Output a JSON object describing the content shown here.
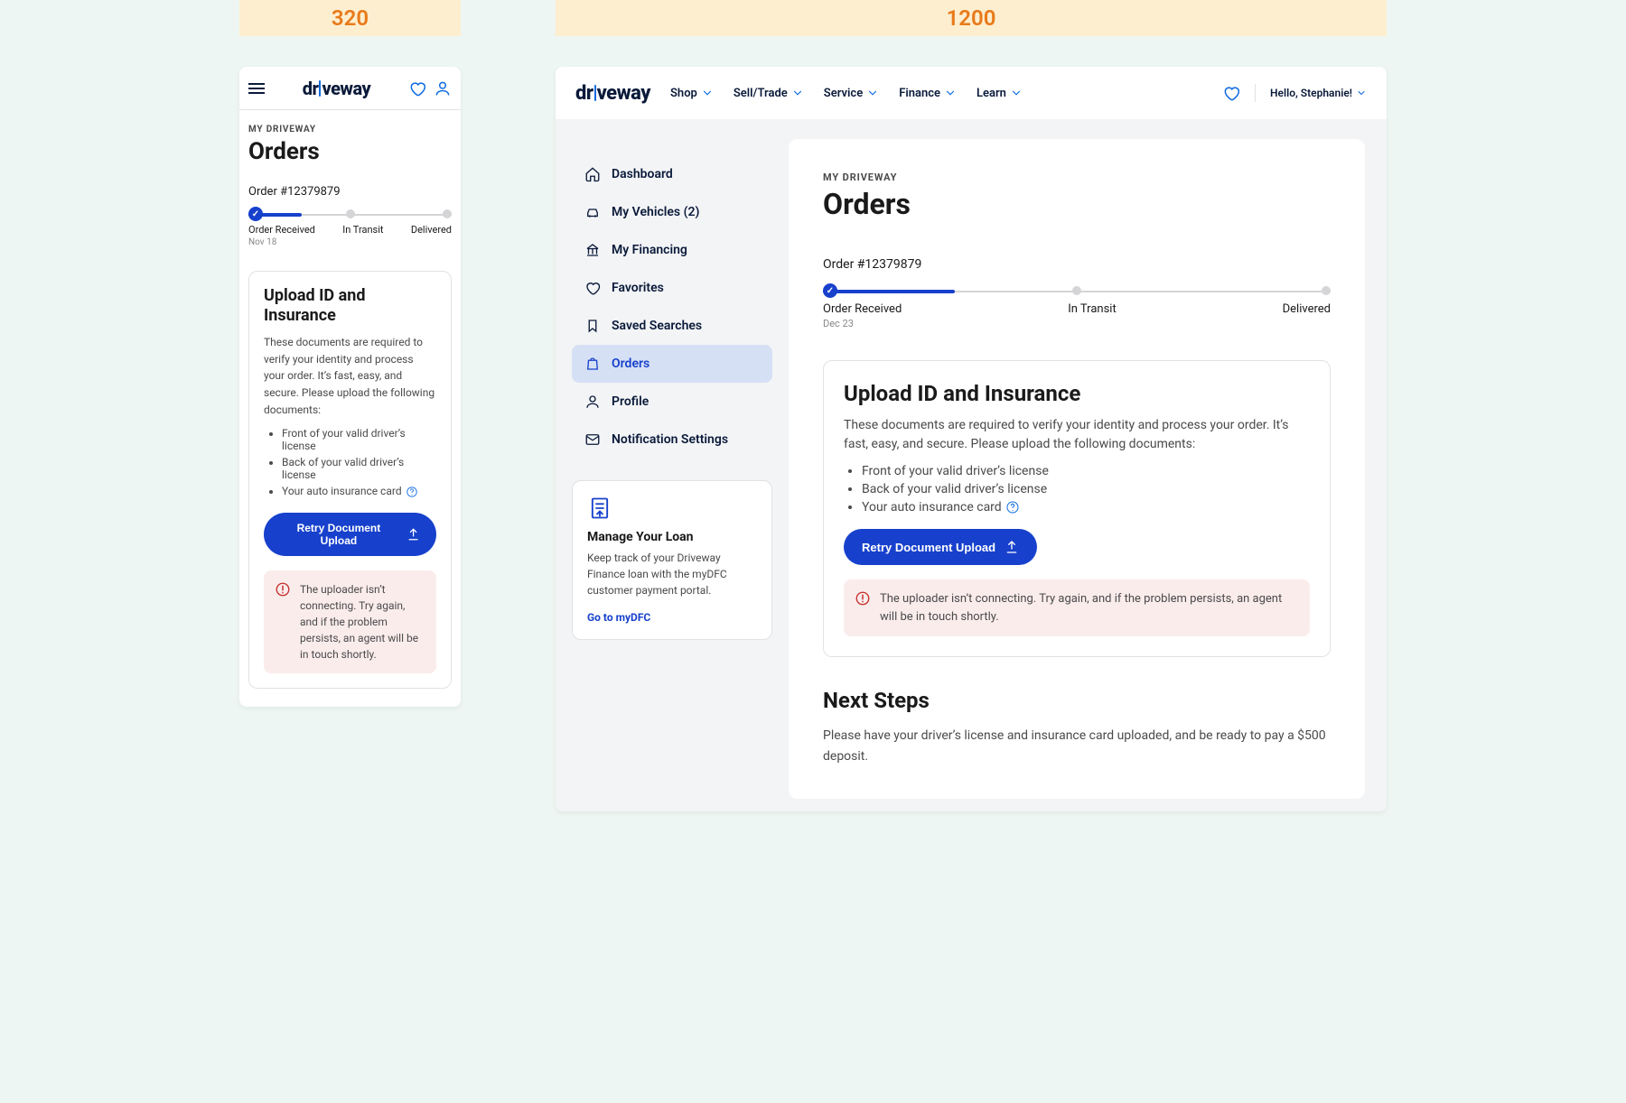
{
  "viewport_labels": {
    "mobile": "320",
    "desktop": "1200"
  },
  "brand": "driveway",
  "topnav": {
    "items": [
      "Shop",
      "Sell/Trade",
      "Service",
      "Finance",
      "Learn"
    ],
    "greeting": "Hello, Stephanie!"
  },
  "sidebar": {
    "items": [
      {
        "icon": "home",
        "label": "Dashboard"
      },
      {
        "icon": "car",
        "label": "My Vehicles (2)"
      },
      {
        "icon": "bank",
        "label": "My Financing"
      },
      {
        "icon": "heart",
        "label": "Favorites"
      },
      {
        "icon": "bookmark",
        "label": "Saved Searches"
      },
      {
        "icon": "bag",
        "label": "Orders",
        "active": true
      },
      {
        "icon": "user",
        "label": "Profile"
      },
      {
        "icon": "mail",
        "label": "Notification Settings"
      }
    ],
    "loan_card": {
      "title": "Manage Your Loan",
      "body": "Keep track of your Driveway Finance loan with the myDFC customer payment portal.",
      "link": "Go to myDFC"
    }
  },
  "page": {
    "eyebrow": "MY DRIVEWAY",
    "title": "Orders",
    "order_label": "Order #12379879",
    "progress": {
      "percent": 26,
      "steps": [
        "Order Received",
        "In Transit",
        "Delivered"
      ],
      "date_desktop": "Dec 23",
      "date_mobile": "Nov 18"
    },
    "upload_card": {
      "title_mobile": "Upload ID and Insurance",
      "title_desktop": "Upload ID and Insurance",
      "body": "These documents are required to verify your identity and process your order. It’s fast, easy, and secure. Please upload the following documents:",
      "items": [
        "Front of your valid driver’s license",
        "Back of your valid driver’s license",
        "Your auto insurance card"
      ],
      "button": "Retry Document Upload",
      "error": "The uploader isn’t connecting. Try again, and if the problem persists, an agent will be in touch shortly."
    },
    "next_steps": {
      "title": "Next Steps",
      "body": "Please have your driver’s license and insurance card uploaded, and be ready to pay a $500 deposit."
    }
  }
}
